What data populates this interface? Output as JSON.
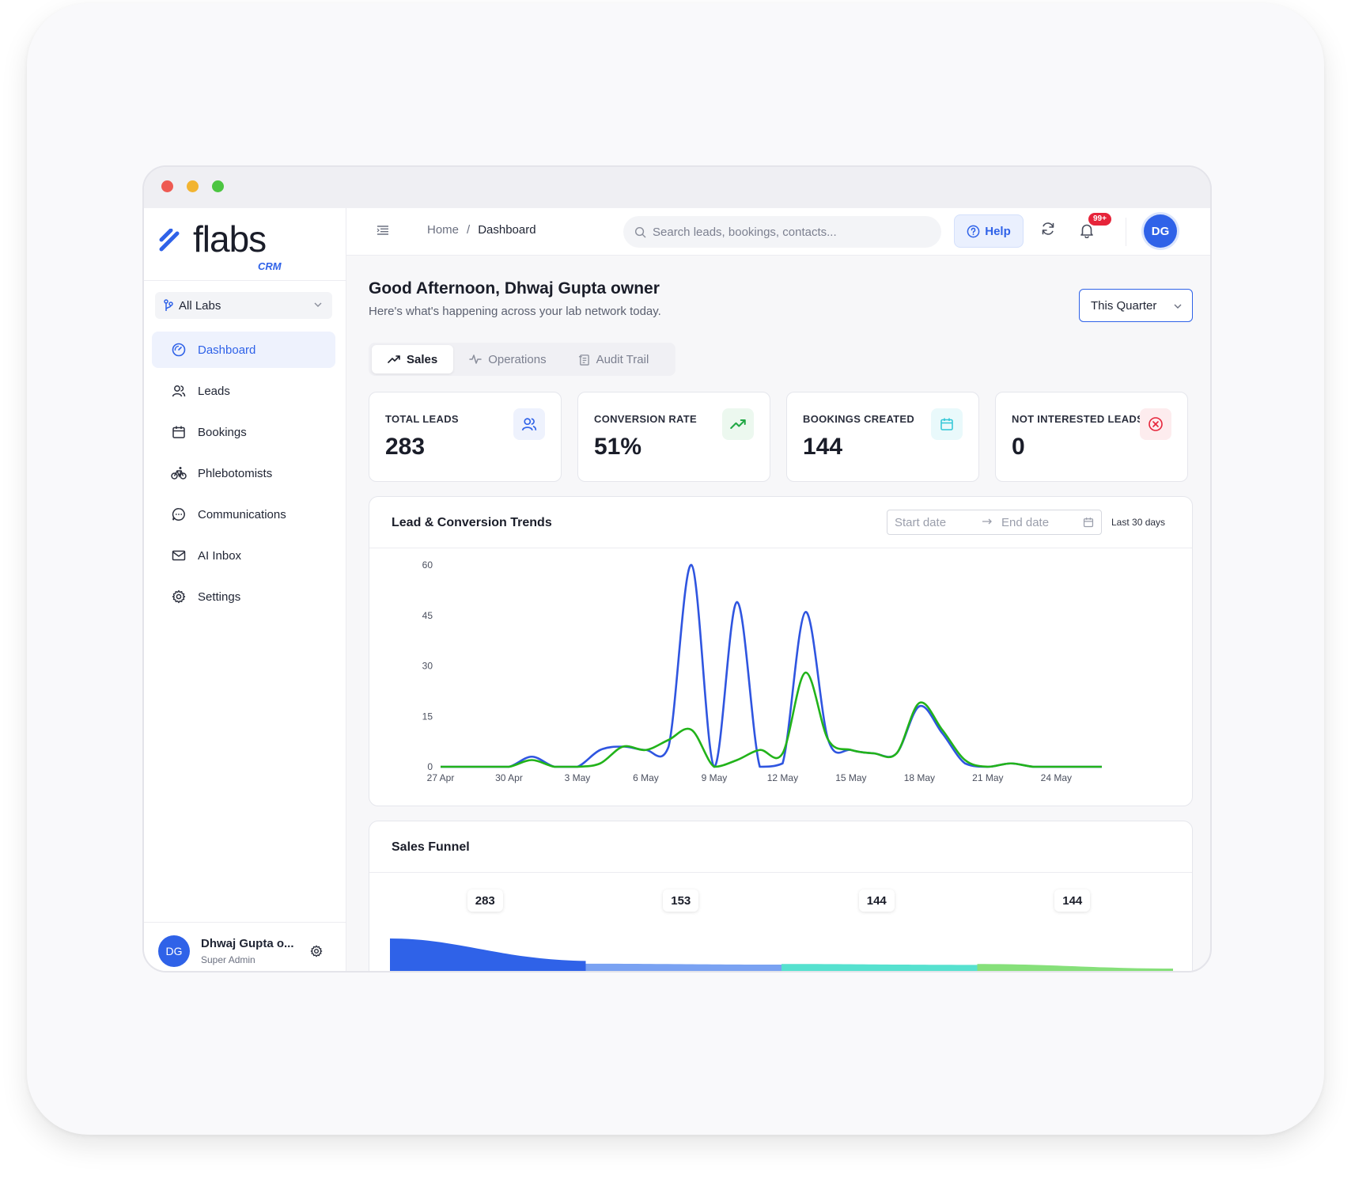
{
  "window": {
    "controls": [
      "close",
      "minimize",
      "maximize"
    ]
  },
  "brand": {
    "name": "flabs",
    "sub": "CRM",
    "accent": "#2f62e8"
  },
  "sidebar": {
    "lab_select": "All Labs",
    "items": [
      {
        "label": "Dashboard",
        "icon": "dashboard-gauge-icon",
        "active": true
      },
      {
        "label": "Leads",
        "icon": "users-icon"
      },
      {
        "label": "Bookings",
        "icon": "calendar-icon"
      },
      {
        "label": "Phlebotomists",
        "icon": "bicycle-icon"
      },
      {
        "label": "Communications",
        "icon": "chat-bubble-icon"
      },
      {
        "label": "AI Inbox",
        "icon": "mail-icon"
      },
      {
        "label": "Settings",
        "icon": "gear-icon"
      }
    ],
    "user": {
      "initials": "DG",
      "name": "Dhwaj Gupta o...",
      "role": "Super Admin"
    }
  },
  "topbar": {
    "breadcrumb": {
      "home": "Home",
      "separator": "/",
      "current": "Dashboard"
    },
    "search_placeholder": "Search leads, bookings, contacts...",
    "help_label": "Help",
    "notification_badge": "99+",
    "avatar_initials": "DG"
  },
  "header": {
    "greeting": "Good Afternoon, Dhwaj Gupta owner",
    "subtitle": "Here's what's happening across your lab network today.",
    "period_select": "This Quarter"
  },
  "tabs": [
    {
      "label": "Sales",
      "active": true
    },
    {
      "label": "Operations"
    },
    {
      "label": "Audit Trail"
    }
  ],
  "stats": [
    {
      "label": "TOTAL LEADS",
      "value": "283",
      "icon": "users-icon",
      "color": "#2f62e8",
      "bg": "#eef2fd"
    },
    {
      "label": "CONVERSION RATE",
      "value": "51%",
      "icon": "trending-up-icon",
      "color": "#22a845",
      "bg": "#ecf8ef"
    },
    {
      "label": "BOOKINGS CREATED",
      "value": "144",
      "icon": "calendar-icon",
      "color": "#2fc6d6",
      "bg": "#e9f9fb"
    },
    {
      "label": "NOT INTERESTED LEADS",
      "value": "0",
      "icon": "x-circle-icon",
      "color": "#e6243a",
      "bg": "#fdecee"
    }
  ],
  "trend_panel": {
    "title": "Lead & Conversion Trends",
    "start_placeholder": "Start date",
    "end_placeholder": "End date",
    "range_label": "Last 30 days"
  },
  "chart_data": {
    "type": "line",
    "title": "Lead & Conversion Trends",
    "x": [
      "27 Apr",
      "28 Apr",
      "29 Apr",
      "30 Apr",
      "1 May",
      "2 May",
      "3 May",
      "4 May",
      "5 May",
      "6 May",
      "7 May",
      "8 May",
      "9 May",
      "10 May",
      "11 May",
      "12 May",
      "13 May",
      "14 May",
      "15 May",
      "16 May",
      "17 May",
      "18 May",
      "19 May",
      "20 May",
      "21 May",
      "22 May",
      "23 May",
      "24 May",
      "25 May",
      "26 May"
    ],
    "x_tick_labels": [
      "27 Apr",
      "30 Apr",
      "3 May",
      "6 May",
      "9 May",
      "12 May",
      "15 May",
      "18 May",
      "21 May",
      "24 May"
    ],
    "y_ticks": [
      0,
      15,
      30,
      45,
      60
    ],
    "ylim": [
      0,
      60
    ],
    "grid": false,
    "legend": "none",
    "series": [
      {
        "color": "#2f55e0",
        "values": [
          0,
          0,
          0,
          0,
          3,
          0,
          0,
          5,
          6,
          5,
          6,
          60,
          0,
          49,
          0,
          1,
          46,
          8,
          5,
          4,
          4,
          18,
          10,
          1,
          0,
          1,
          0,
          0,
          0,
          0
        ]
      },
      {
        "color": "#22b31a",
        "values": [
          0,
          0,
          0,
          0,
          2,
          0,
          0,
          1,
          6,
          5,
          8,
          11,
          0,
          2,
          5,
          4,
          28,
          8,
          5,
          4,
          4,
          19,
          11,
          2,
          0,
          1,
          0,
          0,
          0,
          0
        ]
      }
    ]
  },
  "funnel_panel": {
    "title": "Sales Funnel",
    "values": [
      "283",
      "153",
      "144",
      "144"
    ],
    "colors": [
      "#2f62e8",
      "#7aa2f2",
      "#56e1cf",
      "#86e07a"
    ]
  }
}
